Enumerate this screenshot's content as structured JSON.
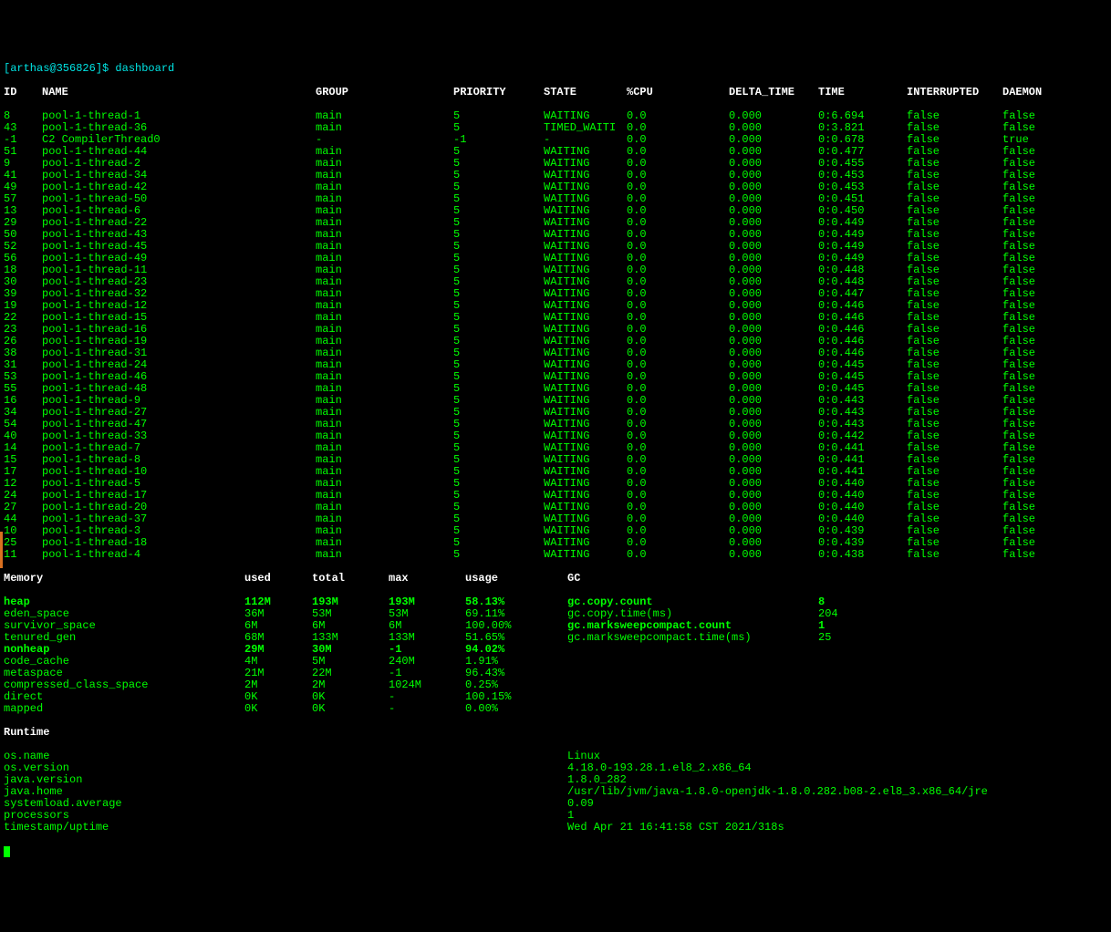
{
  "prompt": "[arthas@356826]$ dashboard",
  "headers": {
    "id": "ID",
    "name": "NAME",
    "group": "GROUP",
    "priority": "PRIORITY",
    "state": "STATE",
    "cpu": "%CPU",
    "delta": "DELTA_TIME",
    "time": "TIME",
    "interrupted": "INTERRUPTED",
    "daemon": "DAEMON"
  },
  "threads": [
    {
      "id": "8",
      "name": "pool-1-thread-1",
      "group": "main",
      "prio": "5",
      "state": "WAITING",
      "cpu": "0.0",
      "delta": "0.000",
      "time": "0:6.694",
      "int": "false",
      "daemon": "false"
    },
    {
      "id": "43",
      "name": "pool-1-thread-36",
      "group": "main",
      "prio": "5",
      "state": "TIMED_WAITI",
      "cpu": "0.0",
      "delta": "0.000",
      "time": "0:3.821",
      "int": "false",
      "daemon": "false"
    },
    {
      "id": "-1",
      "name": "C2 CompilerThread0",
      "group": "-",
      "prio": "-1",
      "state": "-",
      "cpu": "0.0",
      "delta": "0.000",
      "time": "0:0.678",
      "int": "false",
      "daemon": "true"
    },
    {
      "id": "51",
      "name": "pool-1-thread-44",
      "group": "main",
      "prio": "5",
      "state": "WAITING",
      "cpu": "0.0",
      "delta": "0.000",
      "time": "0:0.477",
      "int": "false",
      "daemon": "false"
    },
    {
      "id": "9",
      "name": "pool-1-thread-2",
      "group": "main",
      "prio": "5",
      "state": "WAITING",
      "cpu": "0.0",
      "delta": "0.000",
      "time": "0:0.455",
      "int": "false",
      "daemon": "false"
    },
    {
      "id": "41",
      "name": "pool-1-thread-34",
      "group": "main",
      "prio": "5",
      "state": "WAITING",
      "cpu": "0.0",
      "delta": "0.000",
      "time": "0:0.453",
      "int": "false",
      "daemon": "false"
    },
    {
      "id": "49",
      "name": "pool-1-thread-42",
      "group": "main",
      "prio": "5",
      "state": "WAITING",
      "cpu": "0.0",
      "delta": "0.000",
      "time": "0:0.453",
      "int": "false",
      "daemon": "false"
    },
    {
      "id": "57",
      "name": "pool-1-thread-50",
      "group": "main",
      "prio": "5",
      "state": "WAITING",
      "cpu": "0.0",
      "delta": "0.000",
      "time": "0:0.451",
      "int": "false",
      "daemon": "false"
    },
    {
      "id": "13",
      "name": "pool-1-thread-6",
      "group": "main",
      "prio": "5",
      "state": "WAITING",
      "cpu": "0.0",
      "delta": "0.000",
      "time": "0:0.450",
      "int": "false",
      "daemon": "false"
    },
    {
      "id": "29",
      "name": "pool-1-thread-22",
      "group": "main",
      "prio": "5",
      "state": "WAITING",
      "cpu": "0.0",
      "delta": "0.000",
      "time": "0:0.449",
      "int": "false",
      "daemon": "false"
    },
    {
      "id": "50",
      "name": "pool-1-thread-43",
      "group": "main",
      "prio": "5",
      "state": "WAITING",
      "cpu": "0.0",
      "delta": "0.000",
      "time": "0:0.449",
      "int": "false",
      "daemon": "false"
    },
    {
      "id": "52",
      "name": "pool-1-thread-45",
      "group": "main",
      "prio": "5",
      "state": "WAITING",
      "cpu": "0.0",
      "delta": "0.000",
      "time": "0:0.449",
      "int": "false",
      "daemon": "false"
    },
    {
      "id": "56",
      "name": "pool-1-thread-49",
      "group": "main",
      "prio": "5",
      "state": "WAITING",
      "cpu": "0.0",
      "delta": "0.000",
      "time": "0:0.449",
      "int": "false",
      "daemon": "false"
    },
    {
      "id": "18",
      "name": "pool-1-thread-11",
      "group": "main",
      "prio": "5",
      "state": "WAITING",
      "cpu": "0.0",
      "delta": "0.000",
      "time": "0:0.448",
      "int": "false",
      "daemon": "false"
    },
    {
      "id": "30",
      "name": "pool-1-thread-23",
      "group": "main",
      "prio": "5",
      "state": "WAITING",
      "cpu": "0.0",
      "delta": "0.000",
      "time": "0:0.448",
      "int": "false",
      "daemon": "false"
    },
    {
      "id": "39",
      "name": "pool-1-thread-32",
      "group": "main",
      "prio": "5",
      "state": "WAITING",
      "cpu": "0.0",
      "delta": "0.000",
      "time": "0:0.447",
      "int": "false",
      "daemon": "false"
    },
    {
      "id": "19",
      "name": "pool-1-thread-12",
      "group": "main",
      "prio": "5",
      "state": "WAITING",
      "cpu": "0.0",
      "delta": "0.000",
      "time": "0:0.446",
      "int": "false",
      "daemon": "false"
    },
    {
      "id": "22",
      "name": "pool-1-thread-15",
      "group": "main",
      "prio": "5",
      "state": "WAITING",
      "cpu": "0.0",
      "delta": "0.000",
      "time": "0:0.446",
      "int": "false",
      "daemon": "false"
    },
    {
      "id": "23",
      "name": "pool-1-thread-16",
      "group": "main",
      "prio": "5",
      "state": "WAITING",
      "cpu": "0.0",
      "delta": "0.000",
      "time": "0:0.446",
      "int": "false",
      "daemon": "false"
    },
    {
      "id": "26",
      "name": "pool-1-thread-19",
      "group": "main",
      "prio": "5",
      "state": "WAITING",
      "cpu": "0.0",
      "delta": "0.000",
      "time": "0:0.446",
      "int": "false",
      "daemon": "false"
    },
    {
      "id": "38",
      "name": "pool-1-thread-31",
      "group": "main",
      "prio": "5",
      "state": "WAITING",
      "cpu": "0.0",
      "delta": "0.000",
      "time": "0:0.446",
      "int": "false",
      "daemon": "false"
    },
    {
      "id": "31",
      "name": "pool-1-thread-24",
      "group": "main",
      "prio": "5",
      "state": "WAITING",
      "cpu": "0.0",
      "delta": "0.000",
      "time": "0:0.445",
      "int": "false",
      "daemon": "false"
    },
    {
      "id": "53",
      "name": "pool-1-thread-46",
      "group": "main",
      "prio": "5",
      "state": "WAITING",
      "cpu": "0.0",
      "delta": "0.000",
      "time": "0:0.445",
      "int": "false",
      "daemon": "false"
    },
    {
      "id": "55",
      "name": "pool-1-thread-48",
      "group": "main",
      "prio": "5",
      "state": "WAITING",
      "cpu": "0.0",
      "delta": "0.000",
      "time": "0:0.445",
      "int": "false",
      "daemon": "false"
    },
    {
      "id": "16",
      "name": "pool-1-thread-9",
      "group": "main",
      "prio": "5",
      "state": "WAITING",
      "cpu": "0.0",
      "delta": "0.000",
      "time": "0:0.443",
      "int": "false",
      "daemon": "false"
    },
    {
      "id": "34",
      "name": "pool-1-thread-27",
      "group": "main",
      "prio": "5",
      "state": "WAITING",
      "cpu": "0.0",
      "delta": "0.000",
      "time": "0:0.443",
      "int": "false",
      "daemon": "false"
    },
    {
      "id": "54",
      "name": "pool-1-thread-47",
      "group": "main",
      "prio": "5",
      "state": "WAITING",
      "cpu": "0.0",
      "delta": "0.000",
      "time": "0:0.443",
      "int": "false",
      "daemon": "false"
    },
    {
      "id": "40",
      "name": "pool-1-thread-33",
      "group": "main",
      "prio": "5",
      "state": "WAITING",
      "cpu": "0.0",
      "delta": "0.000",
      "time": "0:0.442",
      "int": "false",
      "daemon": "false"
    },
    {
      "id": "14",
      "name": "pool-1-thread-7",
      "group": "main",
      "prio": "5",
      "state": "WAITING",
      "cpu": "0.0",
      "delta": "0.000",
      "time": "0:0.441",
      "int": "false",
      "daemon": "false"
    },
    {
      "id": "15",
      "name": "pool-1-thread-8",
      "group": "main",
      "prio": "5",
      "state": "WAITING",
      "cpu": "0.0",
      "delta": "0.000",
      "time": "0:0.441",
      "int": "false",
      "daemon": "false"
    },
    {
      "id": "17",
      "name": "pool-1-thread-10",
      "group": "main",
      "prio": "5",
      "state": "WAITING",
      "cpu": "0.0",
      "delta": "0.000",
      "time": "0:0.441",
      "int": "false",
      "daemon": "false"
    },
    {
      "id": "12",
      "name": "pool-1-thread-5",
      "group": "main",
      "prio": "5",
      "state": "WAITING",
      "cpu": "0.0",
      "delta": "0.000",
      "time": "0:0.440",
      "int": "false",
      "daemon": "false"
    },
    {
      "id": "24",
      "name": "pool-1-thread-17",
      "group": "main",
      "prio": "5",
      "state": "WAITING",
      "cpu": "0.0",
      "delta": "0.000",
      "time": "0:0.440",
      "int": "false",
      "daemon": "false"
    },
    {
      "id": "27",
      "name": "pool-1-thread-20",
      "group": "main",
      "prio": "5",
      "state": "WAITING",
      "cpu": "0.0",
      "delta": "0.000",
      "time": "0:0.440",
      "int": "false",
      "daemon": "false"
    },
    {
      "id": "44",
      "name": "pool-1-thread-37",
      "group": "main",
      "prio": "5",
      "state": "WAITING",
      "cpu": "0.0",
      "delta": "0.000",
      "time": "0:0.440",
      "int": "false",
      "daemon": "false"
    },
    {
      "id": "10",
      "name": "pool-1-thread-3",
      "group": "main",
      "prio": "5",
      "state": "WAITING",
      "cpu": "0.0",
      "delta": "0.000",
      "time": "0:0.439",
      "int": "false",
      "daemon": "false"
    },
    {
      "id": "25",
      "name": "pool-1-thread-18",
      "group": "main",
      "prio": "5",
      "state": "WAITING",
      "cpu": "0.0",
      "delta": "0.000",
      "time": "0:0.439",
      "int": "false",
      "daemon": "false"
    },
    {
      "id": "11",
      "name": "pool-1-thread-4",
      "group": "main",
      "prio": "5",
      "state": "WAITING",
      "cpu": "0.0",
      "delta": "0.000",
      "time": "0:0.438",
      "int": "false",
      "daemon": "false"
    }
  ],
  "mem_header": {
    "title": "Memory",
    "used": "used",
    "total": "total",
    "max": "max",
    "usage": "usage",
    "gc": "GC"
  },
  "memory": [
    {
      "name": "heap",
      "used": "112M",
      "total": "193M",
      "max": "193M",
      "usage": "58.13%",
      "bold": true
    },
    {
      "name": "eden_space",
      "used": "36M",
      "total": "53M",
      "max": "53M",
      "usage": "69.11%"
    },
    {
      "name": "survivor_space",
      "used": "6M",
      "total": "6M",
      "max": "6M",
      "usage": "100.00%"
    },
    {
      "name": "tenured_gen",
      "used": "68M",
      "total": "133M",
      "max": "133M",
      "usage": "51.65%"
    },
    {
      "name": "nonheap",
      "used": "29M",
      "total": "30M",
      "max": "-1",
      "usage": "94.02%",
      "bold": true
    },
    {
      "name": "code_cache",
      "used": "4M",
      "total": "5M",
      "max": "240M",
      "usage": "1.91%"
    },
    {
      "name": "metaspace",
      "used": "21M",
      "total": "22M",
      "max": "-1",
      "usage": "96.43%"
    },
    {
      "name": "compressed_class_space",
      "used": "2M",
      "total": "2M",
      "max": "1024M",
      "usage": "0.25%"
    },
    {
      "name": "direct",
      "used": "0K",
      "total": "0K",
      "max": "-",
      "usage": "100.15%"
    },
    {
      "name": "mapped",
      "used": "0K",
      "total": "0K",
      "max": "-",
      "usage": "0.00%"
    }
  ],
  "gc": [
    {
      "name": "gc.copy.count",
      "val": "8",
      "bold": true
    },
    {
      "name": "gc.copy.time(ms)",
      "val": "204"
    },
    {
      "name": "gc.marksweepcompact.count",
      "val": "1",
      "bold": true
    },
    {
      "name": "gc.marksweepcompact.time(ms)",
      "val": "25"
    }
  ],
  "runtime_header": "Runtime",
  "runtime": [
    {
      "key": "os.name",
      "val": "Linux"
    },
    {
      "key": "os.version",
      "val": "4.18.0-193.28.1.el8_2.x86_64"
    },
    {
      "key": "java.version",
      "val": "1.8.0_282"
    },
    {
      "key": "java.home",
      "val": "/usr/lib/jvm/java-1.8.0-openjdk-1.8.0.282.b08-2.el8_3.x86_64/jre"
    },
    {
      "key": "systemload.average",
      "val": "0.09"
    },
    {
      "key": "processors",
      "val": "1"
    },
    {
      "key": "timestamp/uptime",
      "val": "Wed Apr 21 16:41:58 CST 2021/318s"
    }
  ]
}
